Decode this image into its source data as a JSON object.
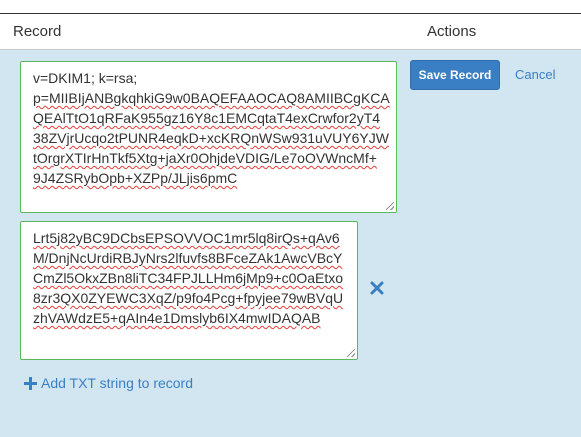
{
  "header": {
    "record_label": "Record",
    "actions_label": "Actions"
  },
  "editor": {
    "txt_strings": [
      {
        "lines": [
          "v=DKIM1; k=rsa;",
          "p=MIIBIjANBgkqhkiG9w0BAQEFAAOCAQ8AMIIBCgKCA",
          "QEAlTtO1qRFaK955gz16Y8c1EMCqtaT4exCrwfor2yT4",
          "38ZVjrUcqo2tPUNR4eqkD+xcKRQnWSw931uVUY6YJW",
          "tOrgrXTIrHnTkf5Xtg+jaXr0OhjdeVDIG/Le7oOVWncMf+",
          "9J4ZSRybOpb+XZPp/JLjis6pmC"
        ]
      },
      {
        "lines": [
          "Lrt5j82yBC9DCbsEPSOVVOC1mr5lq8irQs+qAv6",
          "M/DnjNcUrdiRBJyNrs2lfuvfs8BFceZAk1AwcVBcY",
          "CmZl5OkxZBn8liTC34FPJLLHm6jMp9+c0OaEtxo",
          "8zr3QX0ZYEWC3XqZ/p9fo4Pcg+fpyjee79wBVqU",
          "zhVAWdzE5+qAIn4e1Dmslyb6IX4mwIDAQAB"
        ]
      }
    ],
    "save_label": "Save Record",
    "cancel_label": "Cancel",
    "add_txt_label": "Add TXT string to record"
  },
  "icons": {
    "remove": "times-icon",
    "add": "plus-icon"
  },
  "colors": {
    "panel_bg": "#d2e6f1",
    "field_border": "#5cb85c",
    "primary": "#3a7fc4"
  }
}
